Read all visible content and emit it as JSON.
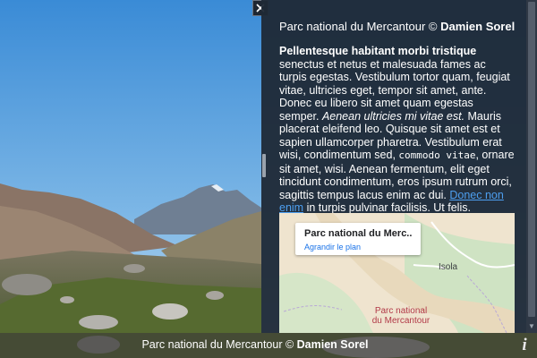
{
  "viewer": {
    "close_icon": "close-icon",
    "info_icon": "info-icon"
  },
  "panel": {
    "title_prefix": "Parc national du Mercantour © ",
    "title_author": "Damien Sorel",
    "body": {
      "bold_lead": "Pellentesque habitant morbi tristique",
      "text1": " senectus et netus et malesuada fames ac turpis egestas. Vestibulum tortor quam, feugiat vitae, ultricies eget, tempor sit amet, ante. Donec eu libero sit amet quam egestas semper. ",
      "italic": "Aenean ultricies mi vitae est.",
      "text2": " Mauris placerat eleifend leo. Quisque sit amet est et sapien ullamcorper pharetra. Vestibulum erat wisi, condimentum sed, ",
      "code": "commodo vitae",
      "text3": ", ornare sit amet, wisi. Aenean fermentum, elit eget tincidunt condimentum, eros ipsum rutrum orci, sagittis tempus lacus enim ac dui. ",
      "link": "Donec non enim",
      "text4": " in turpis pulvinar facilisis. Ut felis."
    }
  },
  "map": {
    "card_title": "Parc national du Merc...",
    "card_link": "Agrandir le plan",
    "town_label": "Isola",
    "park_label_line1": "Parc national",
    "park_label_line2": "du Mercantour"
  },
  "caption": {
    "prefix": "Parc national du Mercantour © ",
    "author": "Damien Sorel"
  },
  "colors": {
    "panel_bg": "#1f2936",
    "link": "#4d9ff0",
    "map_link": "#1a73e8",
    "park_label": "#b23a48"
  }
}
